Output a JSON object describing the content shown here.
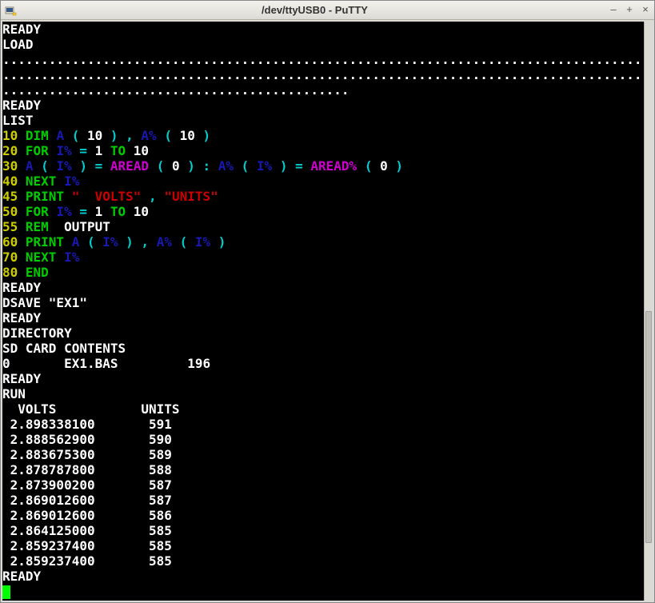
{
  "window": {
    "title": "/dev/ttyUSB0 - PuTTY",
    "minimize": "–",
    "maximize": "+",
    "close": "×"
  },
  "terminal": {
    "ready1": "READY",
    "load": "LOAD",
    "dots1": "......................................................................................................",
    "dots2": "......................................................................................................",
    "dots3": ".............................................",
    "ready2": "READY",
    "list": "LIST",
    "l10_num": "10",
    "l10_dim": " DIM ",
    "l10_a": "A",
    "l10_p1": " ( ",
    "l10_ten": "10",
    "l10_p2": " ) , ",
    "l10_apct": "A%",
    "l10_p3": " ( ",
    "l10_ten2": "10",
    "l10_p4": " )",
    "l20_num": "20",
    "l20_for": " FOR ",
    "l20_ipct": "I%",
    "l20_eq": " = ",
    "l20_one": "1",
    "l20_to": " TO ",
    "l20_ten": "10",
    "l30_num": "30",
    "l30_sp": " ",
    "l30_a": "A",
    "l30_p1": " ( ",
    "l30_ipct": "I%",
    "l30_p2": " ) = ",
    "l30_aread": "AREAD",
    "l30_p3": " ( ",
    "l30_zero": "0",
    "l30_p4": " ) : ",
    "l30_apct": "A%",
    "l30_p5": " ( ",
    "l30_ipct2": "I%",
    "l30_p6": " ) = ",
    "l30_areadpct": "AREAD%",
    "l30_p7": " ( ",
    "l30_zero2": "0",
    "l30_p8": " )",
    "l40_num": "40",
    "l40_next": " NEXT ",
    "l40_ipct": "I%",
    "l45_num": "45",
    "l45_print": " PRINT ",
    "l45_volts": "\"  VOLTS\"",
    "l45_comma": " , ",
    "l45_units": "\"UNITS\"",
    "l50_num": "50",
    "l50_for": " FOR ",
    "l50_ipct": "I%",
    "l50_eq": " = ",
    "l50_one": "1",
    "l50_to": " TO ",
    "l50_ten": "10",
    "l55_num": "55",
    "l55_rem": " REM ",
    "l55_output": " OUTPUT",
    "l60_num": "60",
    "l60_print": " PRINT ",
    "l60_a": "A",
    "l60_p1": " ( ",
    "l60_ipct": "I%",
    "l60_p2": " ) , ",
    "l60_apct": "A%",
    "l60_p3": " ( ",
    "l60_ipct2": "I%",
    "l60_p4": " )",
    "l70_num": "70",
    "l70_next": " NEXT ",
    "l70_ipct": "I%",
    "l80_num": "80",
    "l80_end": " END",
    "ready3": "READY",
    "dsave": "DSAVE \"EX1\"",
    "ready4": "READY",
    "directory": "DIRECTORY",
    "sdcard": "SD CARD CONTENTS",
    "dirline": "0       EX1.BAS         196",
    "ready5": "READY",
    "run": "RUN",
    "header": "  VOLTS           UNITS",
    "r1": " 2.898338100       591",
    "r2": " 2.888562900       590",
    "r3": " 2.883675300       589",
    "r4": " 2.878787800       588",
    "r5": " 2.873900200       587",
    "r6": " 2.869012600       587",
    "r7": " 2.869012600       586",
    "r8": " 2.864125000       585",
    "r9": " 2.859237400       585",
    "r10": " 2.859237400       585",
    "ready6": "READY"
  }
}
